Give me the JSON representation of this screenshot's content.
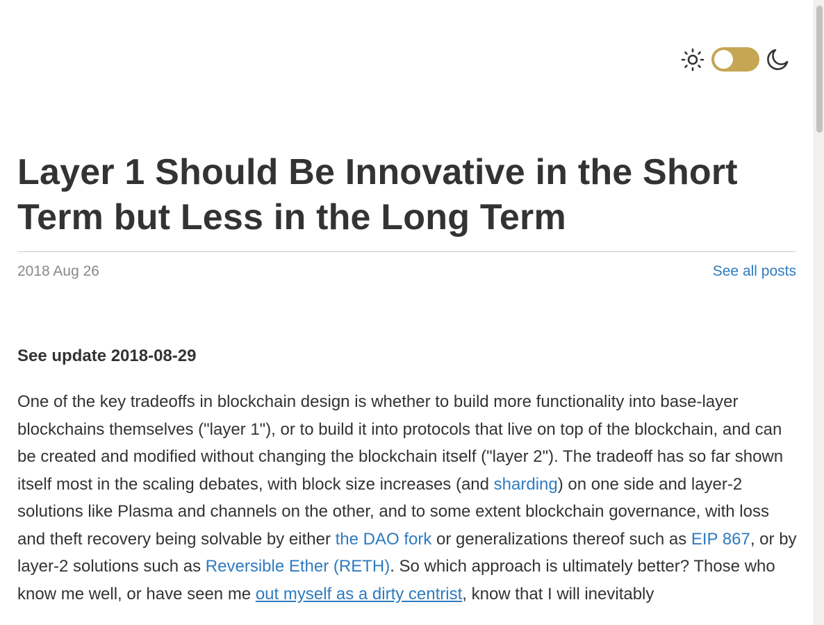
{
  "header": {
    "theme_toggle": {
      "state": "light",
      "accent": "#c4a653",
      "icons": [
        "sun-icon",
        "moon-icon"
      ]
    }
  },
  "post": {
    "title": "Layer 1 Should Be Innovative in the Short Term but Less in the Long Term",
    "date": "2018 Aug 26",
    "see_all_label": "See all posts",
    "update_label": "See update 2018-08-29",
    "paragraph": {
      "t1": "One of the key tradeoffs in blockchain design is whether to build more functionality into base-layer blockchains themselves (\"layer 1\"), or to build it into protocols that live on top of the blockchain, and can be created and modified without changing the blockchain itself (\"layer 2\"). The tradeoff has so far shown itself most in the scaling debates, with block size increases (and ",
      "link_sharding": "sharding",
      "t2": ") on one side and layer-2 solutions like Plasma and channels on the other, and to some extent blockchain governance, with loss and theft recovery being solvable by either ",
      "link_dao": "the DAO fork",
      "t3": " or generalizations thereof such as ",
      "link_eip": "EIP 867",
      "t4": ", or by layer-2 solutions such as ",
      "link_reth": "Reversible Ether (RETH)",
      "t5": ". So which approach is ultimately better? Those who know me well, or have seen me ",
      "link_centrist": "out myself as a dirty centrist",
      "t6": ", know that I will inevitably"
    }
  },
  "colors": {
    "text": "#333333",
    "link": "#2e7bbf",
    "muted": "#888888",
    "rule": "#cccccc"
  }
}
